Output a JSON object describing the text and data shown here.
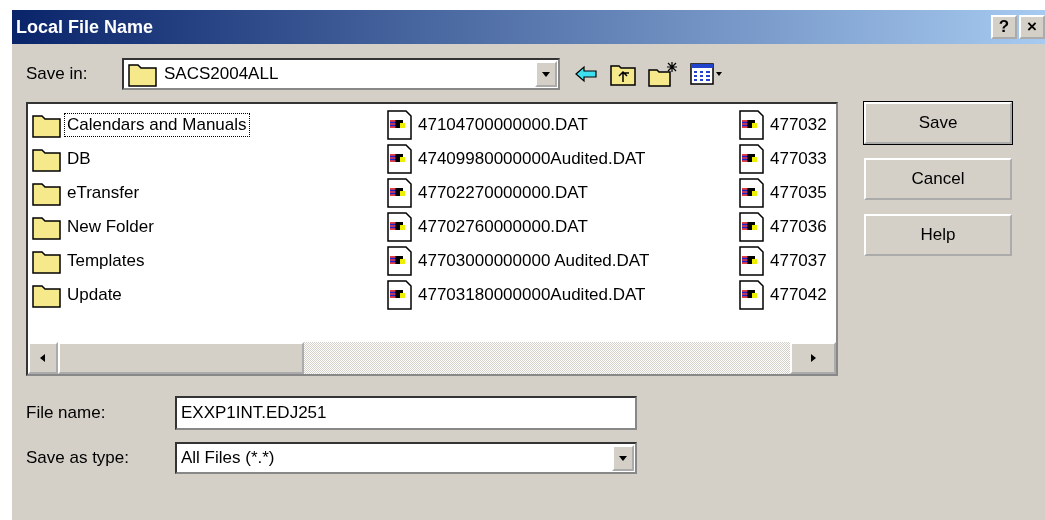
{
  "window": {
    "title": "Local File Name",
    "buttons": [
      "?",
      "×"
    ]
  },
  "save_in": {
    "label": "Save in:",
    "value": "SACS2004ALL"
  },
  "file_list": {
    "columns": [
      {
        "items": [
          {
            "name": "Calendars and Manuals",
            "kind": "folder",
            "focused": true
          },
          {
            "name": "DB",
            "kind": "folder",
            "focused": false
          },
          {
            "name": "eTransfer",
            "kind": "folder",
            "focused": false
          },
          {
            "name": "New Folder",
            "kind": "folder",
            "focused": false
          },
          {
            "name": "Templates",
            "kind": "folder",
            "focused": false
          },
          {
            "name": "Update",
            "kind": "folder",
            "focused": false
          }
        ]
      },
      {
        "items": [
          {
            "name": "47104700000000.DAT",
            "kind": "file",
            "focused": false
          },
          {
            "name": "47409980000000Audited.DAT",
            "kind": "file",
            "focused": false
          },
          {
            "name": "47702270000000.DAT",
            "kind": "file",
            "focused": false
          },
          {
            "name": "47702760000000.DAT",
            "kind": "file",
            "focused": false
          },
          {
            "name": "47703000000000 Audited.DAT",
            "kind": "file",
            "focused": false
          },
          {
            "name": "47703180000000Audited.DAT",
            "kind": "file",
            "focused": false
          }
        ]
      },
      {
        "items": [
          {
            "name": "477032",
            "kind": "file",
            "focused": false
          },
          {
            "name": "477033",
            "kind": "file",
            "focused": false
          },
          {
            "name": "477035",
            "kind": "file",
            "focused": false
          },
          {
            "name": "477036",
            "kind": "file",
            "focused": false
          },
          {
            "name": "477037",
            "kind": "file",
            "focused": false
          },
          {
            "name": "477042",
            "kind": "file",
            "focused": false
          }
        ]
      }
    ]
  },
  "file_name": {
    "label": "File name:",
    "value": "EXXP1INT.EDJ251"
  },
  "save_as_type": {
    "label": "Save as type:",
    "value": "All Files (*.*)"
  },
  "buttons": [
    {
      "label": "Save",
      "default": true
    },
    {
      "label": "Cancel",
      "default": false
    },
    {
      "label": "Help",
      "default": false
    }
  ]
}
